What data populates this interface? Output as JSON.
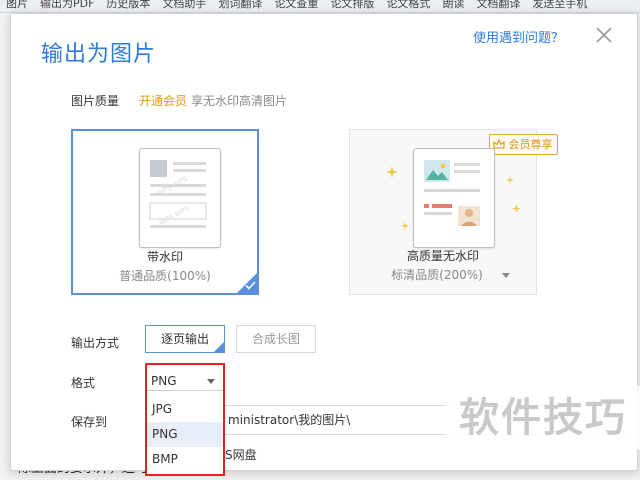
{
  "background": {
    "toolbar_items": [
      "图片",
      "输出为PDF",
      "历史版本",
      "文档助手",
      "划词翻译",
      "论文查重",
      "论文排版",
      "论文格式",
      "朗读",
      "文档翻译",
      "发送至手机"
    ],
    "doc_text": "除上面的要求外，还可以去掉水印。"
  },
  "dialog": {
    "title": "输出为图片",
    "help_link": "使用遇到问题？",
    "quality_label": "图片质量",
    "vip_link": "开通会员",
    "vip_desc": "享无水印高清图片",
    "cards": [
      {
        "name": "带水印",
        "sub": "普通品质(100%)",
        "selected": true
      },
      {
        "name": "高质量无水印",
        "sub": "标清品质(200%)",
        "selected": false,
        "badge": "会员尊享"
      }
    ],
    "output_label": "输出方式",
    "output_options": [
      "逐页输出",
      "合成长图"
    ],
    "output_selected": "逐页输出",
    "format_label": "格式",
    "format_value": "PNG",
    "format_options": [
      "JPG",
      "PNG",
      "BMP"
    ],
    "save_label": "保存到",
    "save_path": "ministrator\\我的图片\\",
    "cloud_text": "S网盘"
  },
  "watermark_text": "软件技巧",
  "colors": {
    "accent": "#2f7bd8",
    "gold": "#e09a12",
    "highlight": "#e02222"
  }
}
